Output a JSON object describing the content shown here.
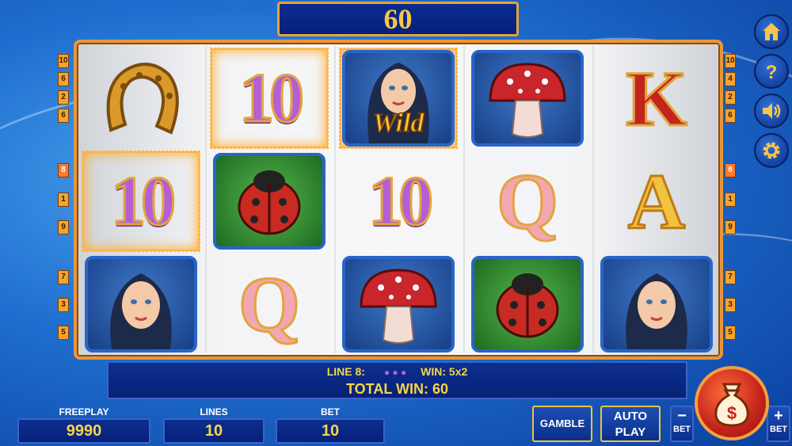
{
  "top_win": "60",
  "left_lines": [
    "6",
    "2",
    "6",
    "8",
    "1",
    "9",
    "7",
    "3",
    "5"
  ],
  "right_lines": [
    "10",
    "4",
    "2",
    "6",
    "8",
    "1",
    "9",
    "7",
    "3",
    "5"
  ],
  "left_top_number": "10",
  "active_line": "8",
  "reels": [
    [
      {
        "symbol": "horseshoe-icon"
      },
      {
        "symbol": "10",
        "win": true
      },
      {
        "symbol": "woman-icon"
      }
    ],
    [
      {
        "symbol": "10",
        "win": true
      },
      {
        "symbol": "ladybug-icon"
      },
      {
        "symbol": "Q"
      }
    ],
    [
      {
        "symbol": "wild-icon",
        "label": "Wild",
        "win": true
      },
      {
        "symbol": "10"
      },
      {
        "symbol": "mushroom-icon"
      }
    ],
    [
      {
        "symbol": "mushroom-icon"
      },
      {
        "symbol": "Q"
      },
      {
        "symbol": "ladybug-icon"
      }
    ],
    [
      {
        "symbol": "K"
      },
      {
        "symbol": "A"
      },
      {
        "symbol": "woman-icon"
      }
    ]
  ],
  "info": {
    "line_label": "LINE 8:",
    "win_label": "WIN: 5x2",
    "total_label": "TOTAL WIN: 60"
  },
  "fields": {
    "freeplay_label": "FREEPLAY",
    "freeplay_value": "9990",
    "lines_label": "LINES",
    "lines_value": "10",
    "bet_label": "BET",
    "bet_value": "10"
  },
  "buttons": {
    "gamble": "GAMBLE",
    "auto": "AUTO",
    "play": "PLAY",
    "bet_minus_sign": "−",
    "bet_minus_label": "BET",
    "bet_plus_sign": "+",
    "bet_plus_label": "BET"
  },
  "side_icons": [
    "home-icon",
    "help-icon",
    "sound-icon",
    "settings-icon"
  ],
  "colors": {
    "gold": "#f6c64a",
    "panel": "#072176",
    "frame": "#e8963a"
  }
}
